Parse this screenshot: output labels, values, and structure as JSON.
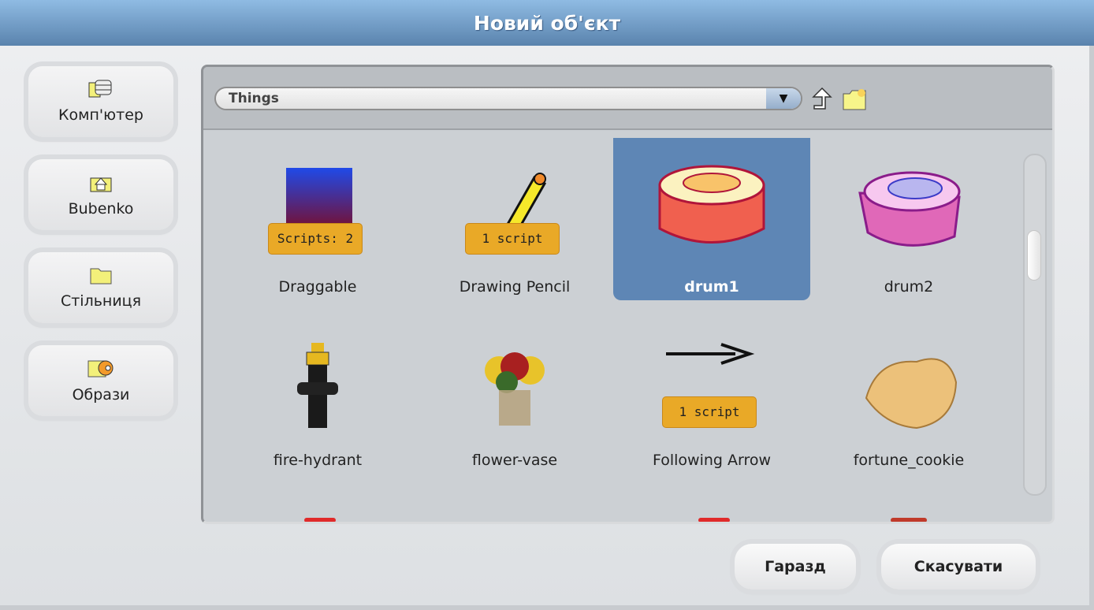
{
  "title": "Новий об'єкт",
  "sidebar": {
    "items": [
      {
        "label": "Комп'ютер",
        "icon": "computer-icon"
      },
      {
        "label": "Bubenko",
        "icon": "home-icon"
      },
      {
        "label": "Стільниця",
        "icon": "folder-icon"
      },
      {
        "label": "Образи",
        "icon": "sprites-icon"
      }
    ]
  },
  "folder": {
    "selected": "Things"
  },
  "items": [
    {
      "label": "Draggable",
      "badge": "Scripts: 2"
    },
    {
      "label": "Drawing Pencil",
      "badge": "1 script"
    },
    {
      "label": "drum1",
      "selected": true
    },
    {
      "label": "drum2"
    },
    {
      "label": "fire-hydrant"
    },
    {
      "label": "flower-vase"
    },
    {
      "label": "Following Arrow",
      "badge": "1 script"
    },
    {
      "label": "fortune_cookie"
    }
  ],
  "buttons": {
    "ok": "Гаразд",
    "cancel": "Скасувати"
  },
  "colors": {
    "title": "#6f9cc9",
    "selection": "#5e86b5",
    "badge": "#e9a927"
  }
}
